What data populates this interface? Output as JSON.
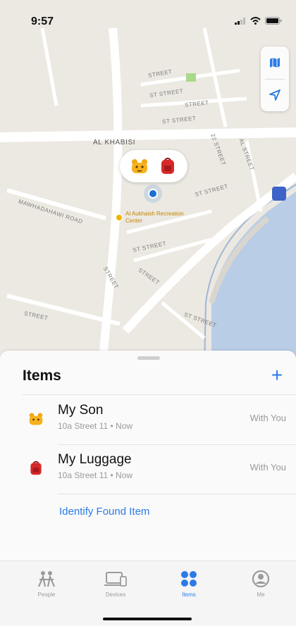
{
  "status_bar": {
    "time": "9:57"
  },
  "map": {
    "district_label": "AL KHABISI",
    "poi_label": "Al Aukhaish Recreation Center",
    "street_labels": [
      "STREET",
      "ST STREET",
      "STREET",
      "ST STREET",
      "22 STREET",
      "AL STREET",
      "ST STREET",
      "MAWHADAHAWI ROAD",
      "ST STREET",
      "STREET",
      "STREET",
      "ST STREET",
      "STREET"
    ]
  },
  "items_sheet": {
    "title": "Items",
    "add_symbol": "+",
    "items": [
      {
        "name": "My Son",
        "subtitle": "10a Street 11 • Now",
        "status": "With You",
        "icon": "teddy-bag-icon"
      },
      {
        "name": "My Luggage",
        "subtitle": "10a Street 11 • Now",
        "status": "With You",
        "icon": "red-backpack-icon"
      }
    ],
    "identify_link": "Identify Found Item"
  },
  "tabs": [
    {
      "label": "People",
      "icon": "people-icon",
      "active": false
    },
    {
      "label": "Devices",
      "icon": "devices-icon",
      "active": false
    },
    {
      "label": "Items",
      "icon": "items-icon",
      "active": true
    },
    {
      "label": "Me",
      "icon": "me-icon",
      "active": false
    }
  ],
  "colors": {
    "accent": "#2c7be5",
    "map_bg": "#ece9e2",
    "water": "#b9cde6"
  }
}
